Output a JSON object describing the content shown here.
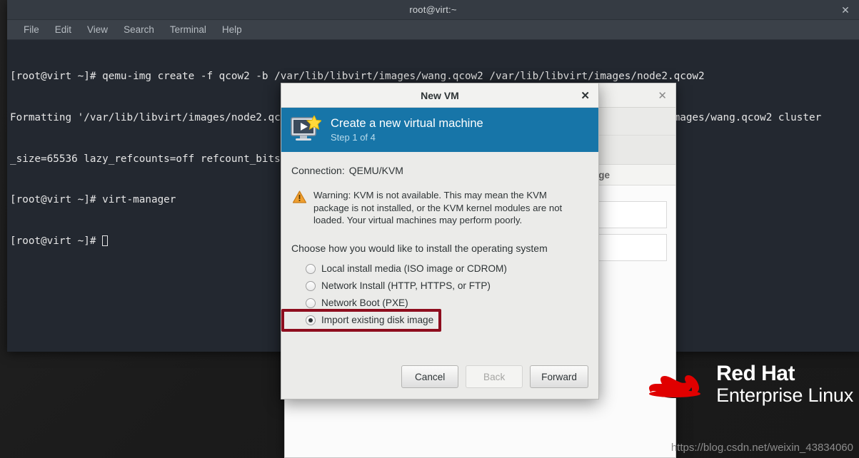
{
  "terminal": {
    "title": "root@virt:~",
    "close_icon": "close-icon",
    "menus": [
      "File",
      "Edit",
      "View",
      "Search",
      "Terminal",
      "Help"
    ],
    "lines": [
      "[root@virt ~]# qemu-img create -f qcow2 -b /var/lib/libvirt/images/wang.qcow2 /var/lib/libvirt/images/node2.qcow2",
      "Formatting '/var/lib/libvirt/images/node2.qcow2', fmt=qcow2 size=21474836480 backing_file=/var/lib/libvirt/images/wang.qcow2 cluster",
      "_size=65536 lazy_refcounts=off refcount_bits=16",
      "[root@virt ~]# virt-manager",
      "[root@virt ~]# "
    ]
  },
  "vmm_window": {
    "close_icon": "close-icon",
    "column_header": "usage",
    "rows": [
      "",
      ""
    ]
  },
  "dialog": {
    "title": "New VM",
    "close_icon": "close-icon",
    "banner": {
      "title": "Create a new virtual machine",
      "step": "Step 1 of 4",
      "icon": "new-vm-icon"
    },
    "connection": {
      "label": "Connection:",
      "value": "QEMU/KVM"
    },
    "warning": {
      "icon": "warning-icon",
      "text": "Warning: KVM is not available. This may mean the KVM package is not installed, or the KVM kernel modules are not loaded. Your virtual machines may perform poorly."
    },
    "choose_label": "Choose how you would like to install the operating system",
    "install_options": [
      {
        "label": "Local install media (ISO image or CDROM)",
        "selected": false
      },
      {
        "label": "Network Install (HTTP, HTTPS, or FTP)",
        "selected": false
      },
      {
        "label": "Network Boot (PXE)",
        "selected": false
      },
      {
        "label": "Import existing disk image",
        "selected": true
      }
    ],
    "highlight_color": "#8e0d1e",
    "buttons": {
      "cancel": "Cancel",
      "back": "Back",
      "forward": "Forward"
    }
  },
  "branding": {
    "line1": "Red Hat",
    "line2": "Enterprise Linux",
    "logo_icon": "red-hat-fedora-icon",
    "logo_color": "#e00000"
  },
  "watermark": "https://blog.csdn.net/weixin_43834060",
  "colors": {
    "banner_blue": "#1775a8",
    "terminal_bg": "#232830",
    "dialog_bg": "#ebebe9"
  }
}
